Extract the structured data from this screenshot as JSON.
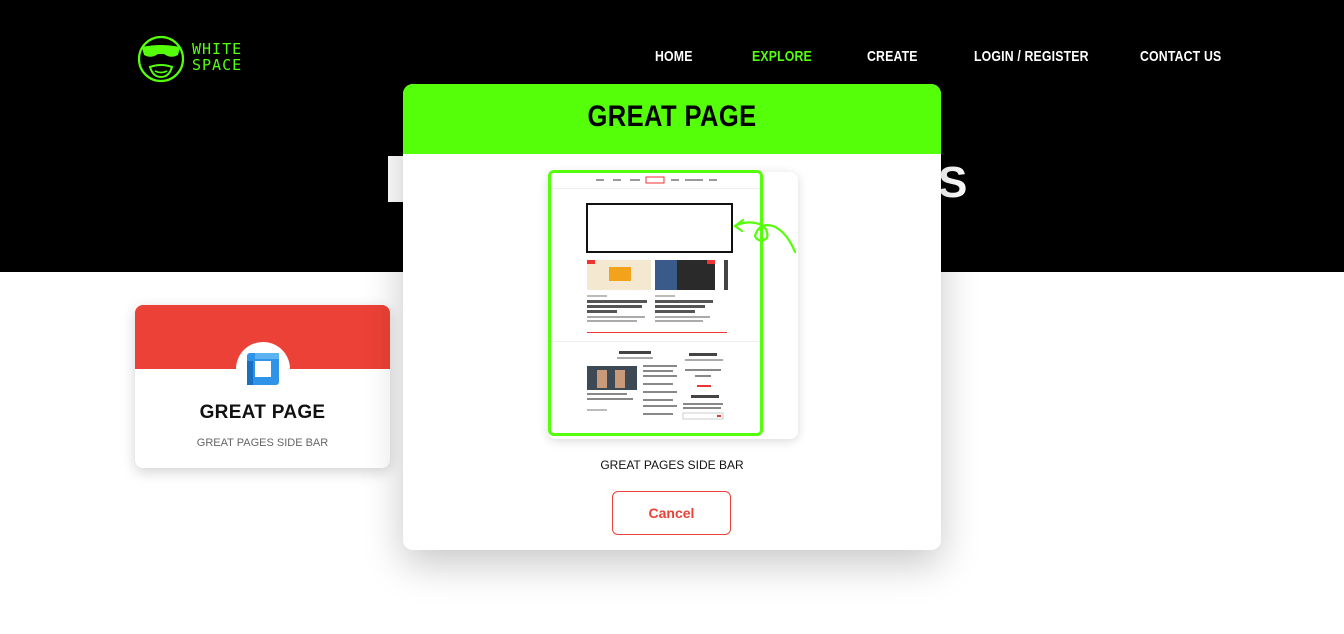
{
  "logo": {
    "line1": "WHITE",
    "line2": "SPACE"
  },
  "nav": {
    "items": [
      {
        "label": "HOME",
        "active": false
      },
      {
        "label": "EXPLORE",
        "active": true
      },
      {
        "label": "CREATE",
        "active": false
      },
      {
        "label": "LOGIN / REGISTER",
        "active": false
      },
      {
        "label": "CONTACT US",
        "active": false
      }
    ]
  },
  "hero": {
    "title_right_fragment": "S"
  },
  "card": {
    "title": "GREAT PAGE",
    "subtitle": "GREAT PAGES SIDE BAR",
    "icon": "layout-icon",
    "accent": "#ec4136"
  },
  "modal": {
    "title": "GREAT PAGE",
    "caption": "GREAT PAGES SIDE BAR",
    "cancel_label": "Cancel",
    "accent": "#55ff0a"
  }
}
